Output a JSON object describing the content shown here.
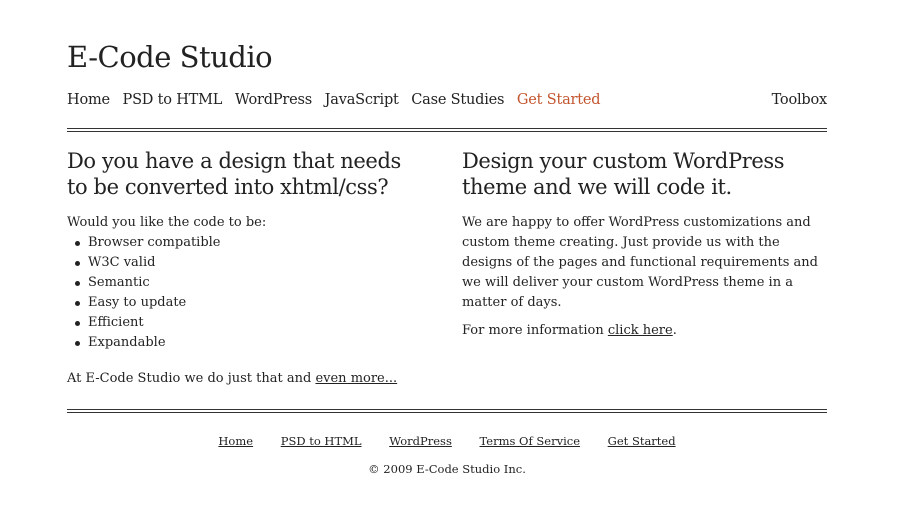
{
  "site": {
    "title": "E-Code Studio"
  },
  "nav": {
    "items": [
      {
        "label": "Home"
      },
      {
        "label": "PSD to HTML"
      },
      {
        "label": "WordPress"
      },
      {
        "label": "JavaScript"
      },
      {
        "label": "Case Studies"
      },
      {
        "label": "Get Started"
      }
    ],
    "active_label": "Get Started",
    "toolbox_label": "Toolbox",
    "accent_color": "#c3552f"
  },
  "left": {
    "heading": "Do you have a design that needs to be converted into xhtml/css?",
    "intro": "Would you like the code to be:",
    "features": [
      "Browser compatible",
      "W3C valid",
      "Semantic",
      "Easy to update",
      "Efficient",
      "Expandable"
    ],
    "outro_text": "At E-Code Studio we do just that and ",
    "outro_link": "even more..."
  },
  "right": {
    "heading": "Design your custom WordPress theme and we will code it.",
    "body": "We are happy to offer WordPress customizations and custom theme creating. Just provide us with the designs of the pages and functional requirements and we will deliver your custom WordPress theme in a matter of days.",
    "more_text": "For more information ",
    "more_link": "click here",
    "more_end": "."
  },
  "footer": {
    "links": [
      {
        "label": "Home"
      },
      {
        "label": "PSD to HTML"
      },
      {
        "label": "WordPress"
      },
      {
        "label": "Terms Of Service"
      },
      {
        "label": "Get Started"
      }
    ],
    "copyright": "© 2009 E-Code Studio Inc."
  }
}
